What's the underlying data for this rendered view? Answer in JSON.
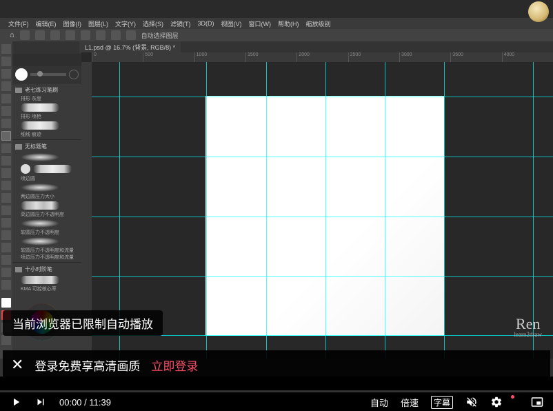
{
  "ps": {
    "menu": [
      "文件(F)",
      "编辑(E)",
      "图像(I)",
      "图层(L)",
      "文字(Y)",
      "选择(S)",
      "滤镜(T)",
      "3D(D)",
      "视图(V)",
      "窗口(W)",
      "帮助(H)",
      "缩放级别"
    ],
    "options_label": "自动选择图层",
    "tab": "L1.psd @ 16.7% (背景, RGB/8) *",
    "ruler_ticks": [
      "0",
      "500",
      "1000",
      "1500",
      "2000",
      "2500",
      "3000",
      "3500",
      "4000"
    ],
    "brush_groups": [
      {
        "name": "老七练习笔刷",
        "items": [
          "排形 灰度",
          "",
          "排形 喷枪",
          "细线 痕迹"
        ]
      },
      {
        "name": "无标题笔",
        "items": [
          "",
          "",
          "喷边圆",
          "两边圆压力大小",
          "",
          "高边圆压力不透明度",
          "",
          "软圆压力不透明度",
          "",
          "软圆压力不透明度和流量",
          "喷边压力不透明度和流量"
        ]
      },
      {
        "name": "十小时阶笔",
        "items": [
          "KMA 可控核心率"
        ]
      }
    ]
  },
  "watermark": {
    "main": "Ren",
    "sub": "learn2draw"
  },
  "notices": {
    "autoplay": "当前浏览器已限制自动播放",
    "login_text": "登录免费享高清画质",
    "login_action": "立即登录"
  },
  "player": {
    "current_time": "00:00",
    "duration": "11:39",
    "sep": " / ",
    "auto": "自动",
    "speed": "倍速",
    "subtitle": "字幕"
  }
}
